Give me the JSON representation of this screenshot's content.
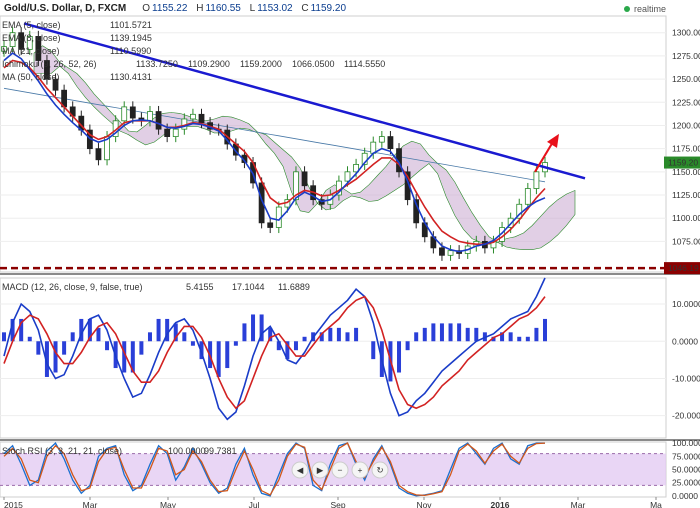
{
  "header": {
    "title": "Gold/U.S. Dollar, D, FXCM",
    "ohlc": [
      {
        "k": "O",
        "v": "1155.22"
      },
      {
        "k": "H",
        "v": "1160.55"
      },
      {
        "k": "L",
        "v": "1153.02"
      },
      {
        "k": "C",
        "v": "1159.20"
      }
    ],
    "realtime_label": "realtime"
  },
  "legends": {
    "ema1": {
      "label": "EMA (5, close)",
      "value": "1101.5721",
      "color": "#d22222"
    },
    "ema2": {
      "label": "EMA (8, close)",
      "value": "1139.1945",
      "color": "#2a8a2a"
    },
    "ma": {
      "label": "MA (21, close)",
      "value": "1110.5990",
      "color": "#1a3cc8"
    },
    "ichimoku": {
      "label": "Ichimoku (9, 26, 52, 26)",
      "values": [
        {
          "v": "1133.7250",
          "color": "#2a6fd0"
        },
        {
          "v": "1109.2900",
          "color": "#c83030"
        },
        {
          "v": "1159.2000",
          "color": "#2a8a2a"
        },
        {
          "v": "1066.0500",
          "color": "#333333"
        },
        {
          "v": "1114.5550",
          "color": "#c83030"
        }
      ]
    },
    "ma2": {
      "label": "MA (50, close)",
      "value": "1130.4131",
      "color": "#d22222"
    },
    "macd": {
      "label": "MACD (12, 26, close, 9, false, true)",
      "values": [
        {
          "v": "5.4155",
          "color": "#1a3cc8"
        },
        {
          "v": "17.1044",
          "color": "#1a3cc8"
        },
        {
          "v": "11.6889",
          "color": "#d22222"
        }
      ]
    },
    "stoch": {
      "label": "Stoch RSI (3, 3, 21, 21, close)",
      "values": [
        {
          "v": "100.0000",
          "color": "#1a6fd0"
        },
        {
          "v": "99.7381",
          "color": "#d2571a"
        }
      ]
    }
  },
  "price_badges": {
    "last": "1159.20",
    "support": "1046.19"
  },
  "colors": {
    "price_up": "#2a8a2a",
    "price_down": "#222222",
    "trendline": "#1a1ad0",
    "support": "#8b0000",
    "cloud": "#c8a8d0",
    "rsi_band": "#e2c8f2",
    "arrow": "#e8101a"
  },
  "chart_data": [
    {
      "type": "line",
      "title": "Gold/U.S. Dollar, D, FXCM",
      "x_ticks": [
        "2015",
        "Mar",
        "May",
        "Jul",
        "Sep",
        "Nov",
        "2016",
        "Mar",
        "Ma"
      ],
      "y_ticks": [
        1075,
        1100,
        1125,
        1150,
        1175,
        1200,
        1225,
        1250,
        1275,
        1300
      ],
      "ylim": [
        1042,
        1318
      ],
      "series": [
        {
          "name": "Price",
          "values": [
            1285,
            1300,
            1282,
            1296,
            1270,
            1250,
            1238,
            1220,
            1210,
            1195,
            1175,
            1163,
            1188,
            1205,
            1220,
            1208,
            1205,
            1215,
            1196,
            1188,
            1196,
            1207,
            1212,
            1203,
            1196,
            1195,
            1180,
            1168,
            1160,
            1138,
            1095,
            1090,
            1112,
            1120,
            1150,
            1135,
            1120,
            1115,
            1125,
            1140,
            1150,
            1158,
            1170,
            1182,
            1188,
            1175,
            1150,
            1120,
            1095,
            1080,
            1068,
            1060,
            1065,
            1062,
            1070,
            1075,
            1068,
            1075,
            1090,
            1100,
            1115,
            1132,
            1150,
            1160
          ]
        },
        {
          "name": "EMA (5, close)",
          "values": [
            1262,
            1270,
            1268,
            1262,
            1252,
            1240,
            1230,
            1220,
            1210,
            1200,
            1190,
            1185,
            1188,
            1195,
            1203,
            1205,
            1205,
            1205,
            1202,
            1198,
            1198,
            1200,
            1203,
            1202,
            1199,
            1196,
            1188,
            1180,
            1172,
            1160,
            1140,
            1122,
            1115,
            1117,
            1125,
            1130,
            1128,
            1124,
            1125,
            1130,
            1136,
            1142,
            1150,
            1158,
            1165,
            1165,
            1158,
            1145,
            1128,
            1112,
            1098,
            1086,
            1080,
            1075,
            1073,
            1072,
            1072,
            1074,
            1080,
            1088,
            1098,
            1110,
            1122,
            1132
          ]
        },
        {
          "name": "MA (21, close)",
          "values": [
            1270,
            1278,
            1272,
            1260,
            1248,
            1234,
            1222,
            1212,
            1203,
            1195,
            1186,
            1182,
            1185,
            1192,
            1200,
            1205,
            1206,
            1205,
            1202,
            1198,
            1197,
            1199,
            1202,
            1201,
            1198,
            1194,
            1184,
            1172,
            1162,
            1148,
            1120,
            1100,
            1098,
            1108,
            1122,
            1128,
            1124,
            1118,
            1120,
            1128,
            1138,
            1148,
            1160,
            1170,
            1175,
            1172,
            1160,
            1140,
            1115,
            1095,
            1080,
            1070,
            1066,
            1064,
            1066,
            1070,
            1072,
            1076,
            1084,
            1094,
            1104,
            1112,
            1118,
            1122
          ]
        }
      ],
      "levels": [
        {
          "name": "Support",
          "value": 1046.19
        }
      ],
      "trendline": [
        {
          "x": 0,
          "y": 1310
        },
        {
          "x": 63,
          "y": 1143
        }
      ],
      "annotations": [
        "1159.20",
        "1046.19"
      ]
    },
    {
      "type": "bar",
      "title": "MACD (12, 26, close, 9, false, true)",
      "y_ticks": [
        -20,
        -10,
        0,
        10
      ],
      "ylim": [
        -26,
        17
      ],
      "series": [
        {
          "name": "MACD",
          "values": [
            -4,
            5,
            10,
            8,
            3,
            -6,
            -10,
            -9,
            -4,
            2,
            6,
            7,
            3,
            -4,
            -10,
            -15,
            -14,
            -9,
            -3,
            2,
            5,
            6,
            3,
            -3,
            -10,
            -18,
            -21,
            -19,
            -12,
            -4,
            2,
            4,
            0,
            -5,
            -6,
            -3,
            1,
            4,
            7,
            9,
            11,
            14,
            12,
            5,
            -5,
            -14,
            -20,
            -19,
            -16,
            -14,
            -11,
            -8,
            -6,
            -4,
            -2,
            0,
            1,
            2,
            4,
            6,
            7,
            8,
            12,
            17
          ]
        },
        {
          "name": "Signal",
          "values": [
            -6,
            0,
            5,
            7,
            6,
            2,
            -3,
            -6,
            -6,
            -3,
            1,
            4,
            5,
            2,
            -3,
            -8,
            -11,
            -11,
            -8,
            -3,
            1,
            4,
            4,
            1,
            -4,
            -10,
            -15,
            -18,
            -16,
            -10,
            -4,
            1,
            2,
            -1,
            -4,
            -4,
            -1,
            2,
            4,
            6,
            9,
            11,
            12,
            9,
            3,
            -5,
            -13,
            -17,
            -18,
            -17,
            -15,
            -12,
            -10,
            -8,
            -5,
            -3,
            -1,
            1,
            2,
            4,
            6,
            7,
            9,
            12
          ]
        }
      ]
    },
    {
      "type": "line",
      "title": "Stoch RSI (3, 3, 21, 21, close)",
      "y_ticks": [
        0,
        25,
        50,
        75,
        100
      ],
      "ylim": [
        -2,
        102
      ],
      "band": [
        20,
        80
      ],
      "series": [
        {
          "name": "K",
          "values": [
            80,
            95,
            60,
            20,
            30,
            85,
            100,
            70,
            30,
            5,
            20,
            75,
            90,
            95,
            40,
            10,
            20,
            60,
            95,
            80,
            30,
            55,
            90,
            60,
            25,
            5,
            15,
            60,
            90,
            40,
            5,
            0,
            40,
            80,
            100,
            90,
            20,
            10,
            60,
            95,
            100,
            60,
            30,
            70,
            95,
            60,
            15,
            5,
            0,
            2,
            5,
            10,
            50,
            90,
            100,
            80,
            60,
            90,
            100,
            70,
            60,
            95,
            100,
            100
          ]
        },
        {
          "name": "D",
          "values": [
            75,
            90,
            70,
            30,
            25,
            75,
            95,
            80,
            40,
            10,
            15,
            65,
            88,
            92,
            50,
            15,
            15,
            50,
            90,
            85,
            40,
            50,
            85,
            65,
            30,
            8,
            10,
            50,
            85,
            50,
            10,
            2,
            30,
            75,
            98,
            92,
            30,
            12,
            50,
            90,
            100,
            65,
            35,
            65,
            92,
            65,
            20,
            8,
            2,
            1,
            4,
            8,
            40,
            85,
            98,
            85,
            62,
            85,
            98,
            75,
            62,
            90,
            99,
            100
          ]
        }
      ]
    }
  ]
}
